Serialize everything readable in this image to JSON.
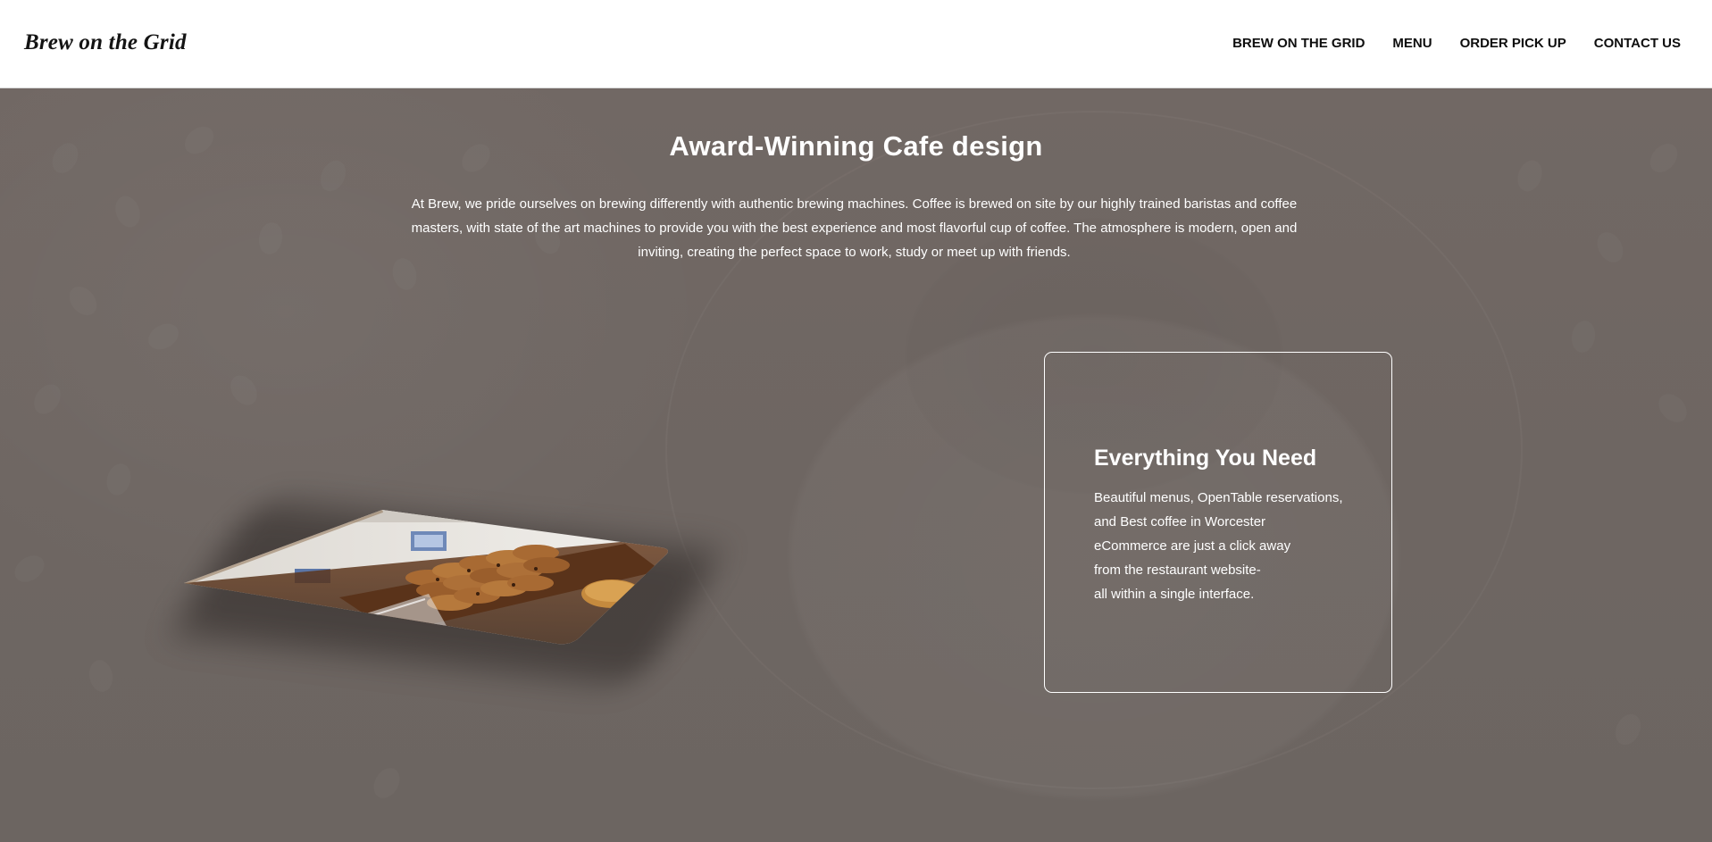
{
  "header": {
    "logo": "Brew on the Grid",
    "nav": [
      {
        "label": "BREW ON THE GRID"
      },
      {
        "label": "MENU"
      },
      {
        "label": "ORDER PICK UP"
      },
      {
        "label": "CONTACT US"
      }
    ]
  },
  "hero": {
    "title": "Award-Winning Cafe design",
    "description": "At Brew, we pride ourselves on brewing differently with authentic brewing machines. Coffee is brewed on site by our highly trained baristas and coffee masters, with state of the art machines to provide you with the best experience and most flavorful cup of coffee. The atmosphere is modern, open and inviting, creating the perfect space to work, study or meet up with friends."
  },
  "card": {
    "title": "Everything You Need",
    "lines": [
      "Beautiful menus, OpenTable reservations,",
      "and Best coffee in Worcester",
      "eCommerce are just a click away",
      "from the restaurant website-",
      "all within a single interface."
    ]
  },
  "colors": {
    "background": "#6f6763",
    "header_bg": "#ffffff",
    "text_light": "#ffffff",
    "text_dark": "#0e0e0e"
  },
  "icons": {
    "photo": "cookies-on-counter-photo"
  }
}
